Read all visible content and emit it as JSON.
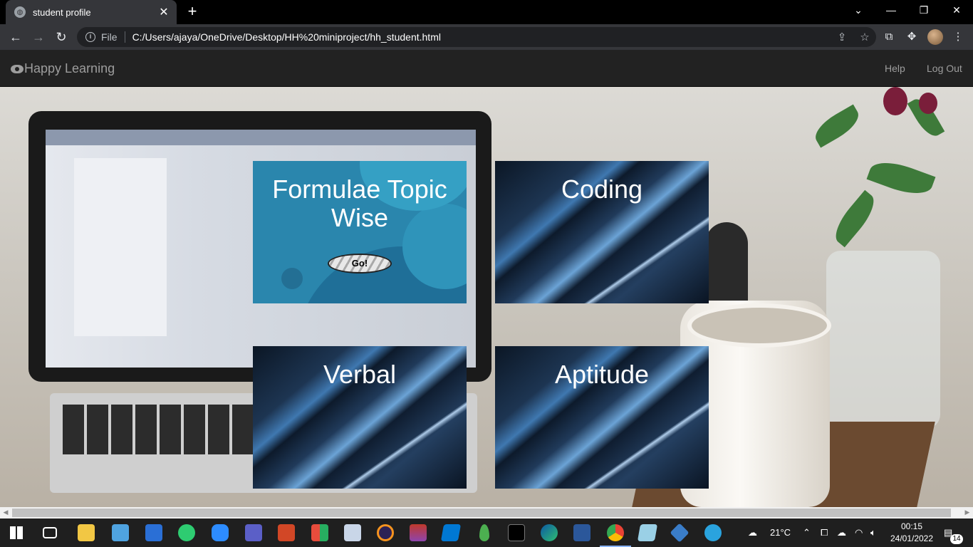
{
  "browser": {
    "tab_title": "student profile",
    "url_scheme_label": "File",
    "url": "C:/Users/ajaya/OneDrive/Desktop/HH%20miniproject/hh_student.html"
  },
  "navbar": {
    "brand": "Happy Learning",
    "links": [
      "Help",
      "Log Out"
    ]
  },
  "cards": [
    {
      "title": "Formulae Topic Wise",
      "button": "Go!"
    },
    {
      "title": "Coding"
    },
    {
      "title": "Verbal"
    },
    {
      "title": "Aptitude"
    }
  ],
  "taskbar": {
    "weather": "21°C",
    "time": "00:15",
    "date": "24/01/2022",
    "notifications": "14"
  },
  "colors": {
    "navbar_bg": "#222222",
    "formulae_card": "#2a86ad",
    "taskbar_bg": "#1f1f1f"
  }
}
